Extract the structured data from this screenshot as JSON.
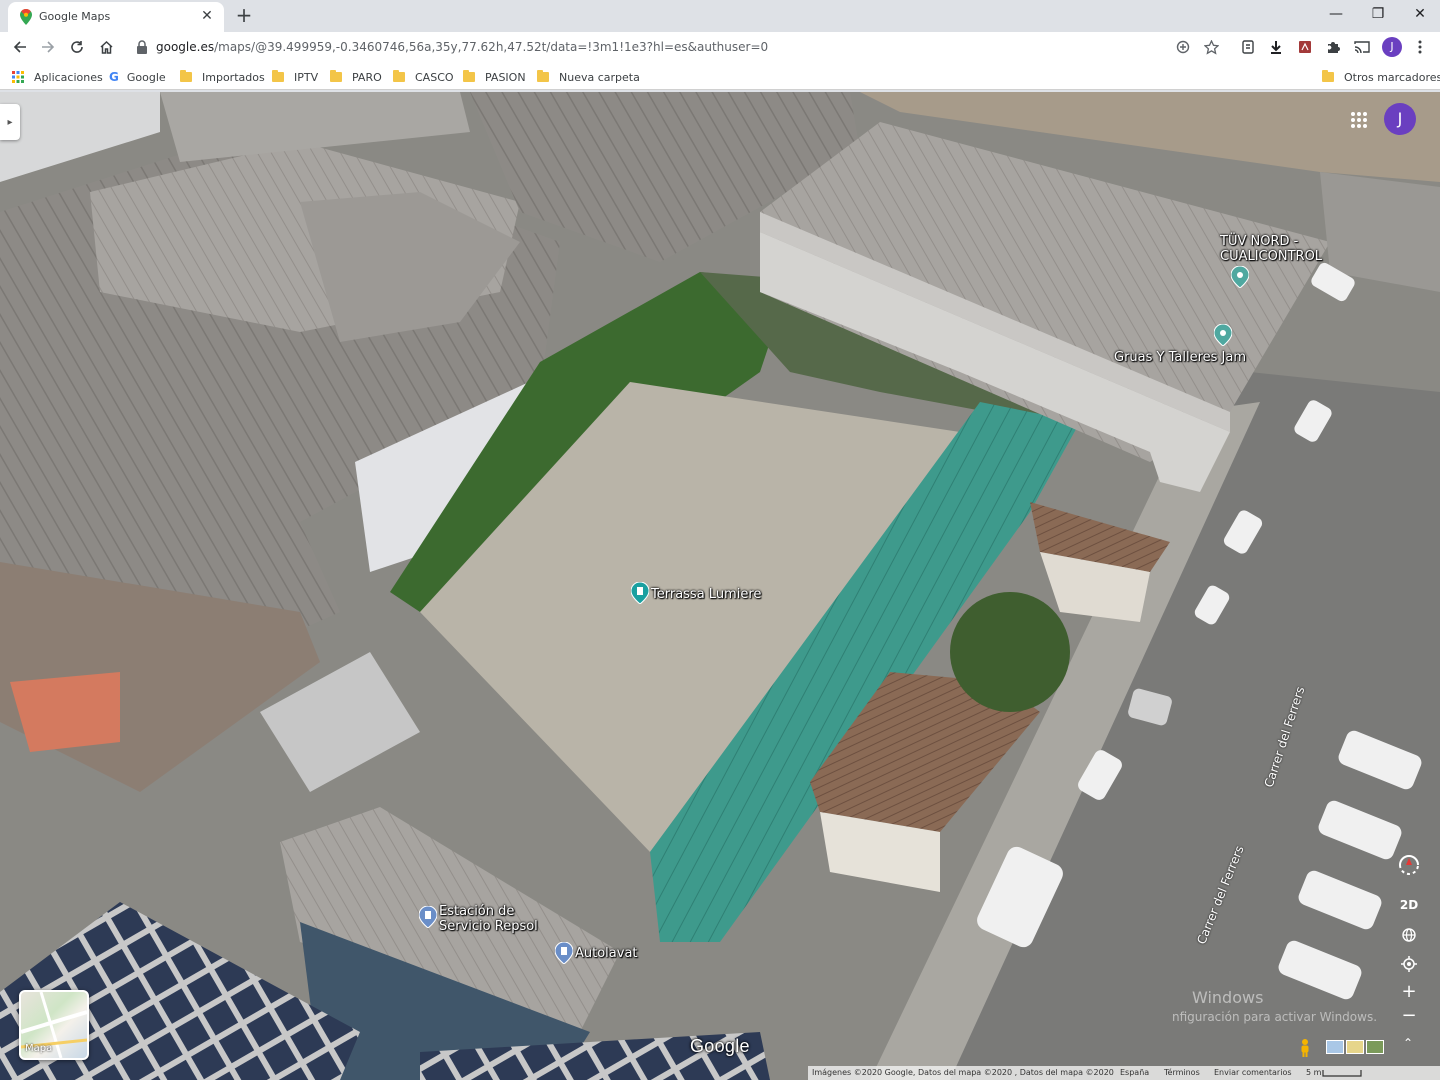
{
  "browser": {
    "tab_title": "Google Maps",
    "tab_close": "✕",
    "new_tab": "+",
    "window_controls": {
      "minimize": "—",
      "restore": "❐",
      "close": "✕"
    },
    "url_host": "google.es",
    "url_path": "/maps/@39.499959,-0.3460746,56a,35y,77.62h,47.52t/data=!3m1!1e3?hl=es&authuser=0",
    "profile_initial": "J"
  },
  "bookmarks": {
    "apps_label": "Aplicaciones",
    "items": [
      "Google",
      "Importados",
      "IPTV",
      "PARO",
      "CASCO",
      "PASION",
      "Nueva carpeta"
    ],
    "other": "Otros marcadores"
  },
  "map": {
    "places": {
      "tuv": "TÜV NORD -\nCUALICONTROL",
      "gruas": "Gruas Y Talleres Jam",
      "terrassa": "Terrassa Lumiere",
      "repsol": "Estación de\nServicio Repsol",
      "autolavat": "Autolavat"
    },
    "streets": {
      "carrer_right": "Carrer del Ferrers",
      "carrer_bottom": "Carrer del Ferrers"
    },
    "account_initial": "J",
    "controls": {
      "view_2d": "2D",
      "zoom_in": "+",
      "zoom_out": "−"
    },
    "minimap_label": "Mapa",
    "google_logo": "Google",
    "attribution": {
      "imagery": "Imágenes ©2020 Google, Datos del mapa ©2020 , Datos del mapa ©2020",
      "country": "España",
      "terms": "Términos",
      "feedback": "Enviar comentarios",
      "scale": "5 m"
    },
    "windows_watermark": {
      "line1": "Windows",
      "line2": "nfiguración para activar Windows."
    }
  }
}
